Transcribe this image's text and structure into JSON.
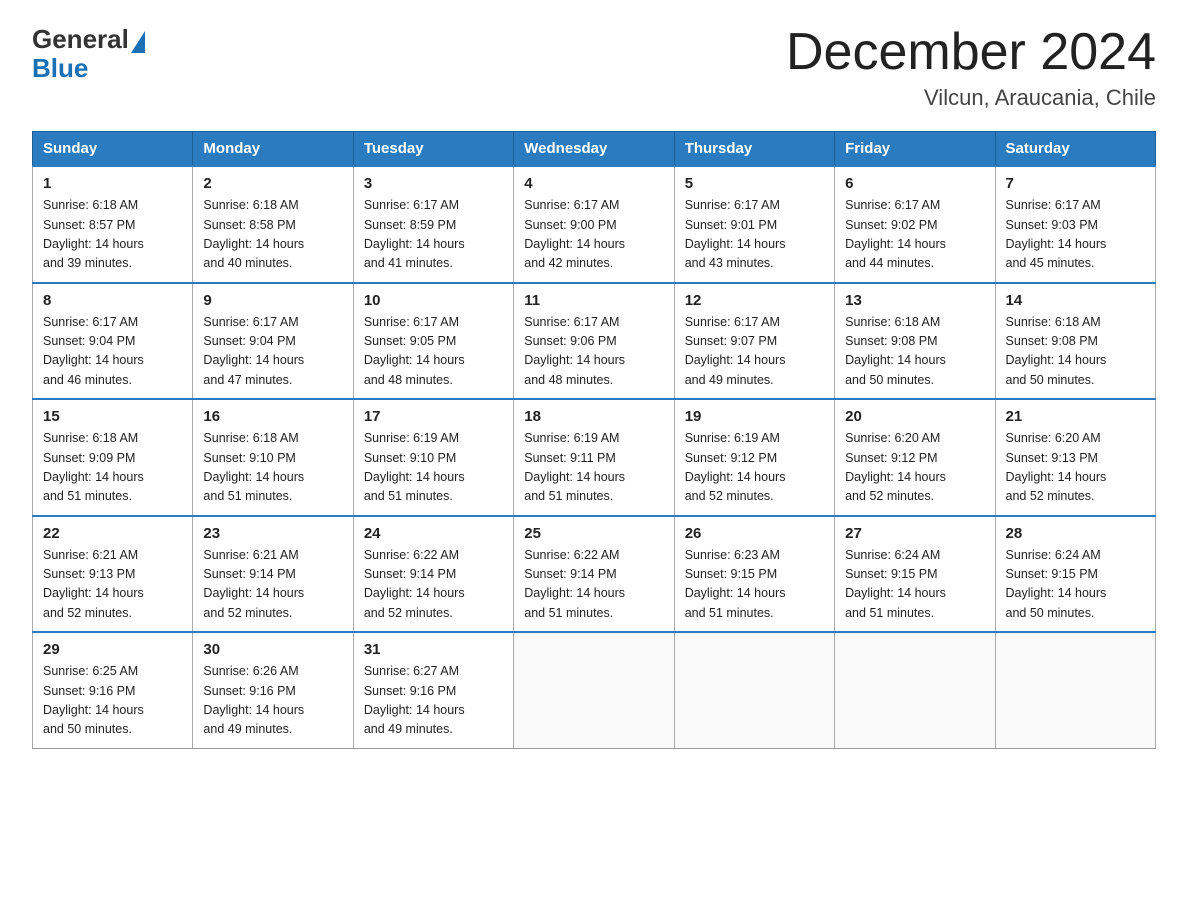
{
  "logo": {
    "general": "General",
    "blue": "Blue"
  },
  "title": "December 2024",
  "location": "Vilcun, Araucania, Chile",
  "headers": [
    "Sunday",
    "Monday",
    "Tuesday",
    "Wednesday",
    "Thursday",
    "Friday",
    "Saturday"
  ],
  "weeks": [
    [
      {
        "day": "1",
        "sunrise": "6:18 AM",
        "sunset": "8:57 PM",
        "daylight": "14 hours and 39 minutes."
      },
      {
        "day": "2",
        "sunrise": "6:18 AM",
        "sunset": "8:58 PM",
        "daylight": "14 hours and 40 minutes."
      },
      {
        "day": "3",
        "sunrise": "6:17 AM",
        "sunset": "8:59 PM",
        "daylight": "14 hours and 41 minutes."
      },
      {
        "day": "4",
        "sunrise": "6:17 AM",
        "sunset": "9:00 PM",
        "daylight": "14 hours and 42 minutes."
      },
      {
        "day": "5",
        "sunrise": "6:17 AM",
        "sunset": "9:01 PM",
        "daylight": "14 hours and 43 minutes."
      },
      {
        "day": "6",
        "sunrise": "6:17 AM",
        "sunset": "9:02 PM",
        "daylight": "14 hours and 44 minutes."
      },
      {
        "day": "7",
        "sunrise": "6:17 AM",
        "sunset": "9:03 PM",
        "daylight": "14 hours and 45 minutes."
      }
    ],
    [
      {
        "day": "8",
        "sunrise": "6:17 AM",
        "sunset": "9:04 PM",
        "daylight": "14 hours and 46 minutes."
      },
      {
        "day": "9",
        "sunrise": "6:17 AM",
        "sunset": "9:04 PM",
        "daylight": "14 hours and 47 minutes."
      },
      {
        "day": "10",
        "sunrise": "6:17 AM",
        "sunset": "9:05 PM",
        "daylight": "14 hours and 48 minutes."
      },
      {
        "day": "11",
        "sunrise": "6:17 AM",
        "sunset": "9:06 PM",
        "daylight": "14 hours and 48 minutes."
      },
      {
        "day": "12",
        "sunrise": "6:17 AM",
        "sunset": "9:07 PM",
        "daylight": "14 hours and 49 minutes."
      },
      {
        "day": "13",
        "sunrise": "6:18 AM",
        "sunset": "9:08 PM",
        "daylight": "14 hours and 50 minutes."
      },
      {
        "day": "14",
        "sunrise": "6:18 AM",
        "sunset": "9:08 PM",
        "daylight": "14 hours and 50 minutes."
      }
    ],
    [
      {
        "day": "15",
        "sunrise": "6:18 AM",
        "sunset": "9:09 PM",
        "daylight": "14 hours and 51 minutes."
      },
      {
        "day": "16",
        "sunrise": "6:18 AM",
        "sunset": "9:10 PM",
        "daylight": "14 hours and 51 minutes."
      },
      {
        "day": "17",
        "sunrise": "6:19 AM",
        "sunset": "9:10 PM",
        "daylight": "14 hours and 51 minutes."
      },
      {
        "day": "18",
        "sunrise": "6:19 AM",
        "sunset": "9:11 PM",
        "daylight": "14 hours and 51 minutes."
      },
      {
        "day": "19",
        "sunrise": "6:19 AM",
        "sunset": "9:12 PM",
        "daylight": "14 hours and 52 minutes."
      },
      {
        "day": "20",
        "sunrise": "6:20 AM",
        "sunset": "9:12 PM",
        "daylight": "14 hours and 52 minutes."
      },
      {
        "day": "21",
        "sunrise": "6:20 AM",
        "sunset": "9:13 PM",
        "daylight": "14 hours and 52 minutes."
      }
    ],
    [
      {
        "day": "22",
        "sunrise": "6:21 AM",
        "sunset": "9:13 PM",
        "daylight": "14 hours and 52 minutes."
      },
      {
        "day": "23",
        "sunrise": "6:21 AM",
        "sunset": "9:14 PM",
        "daylight": "14 hours and 52 minutes."
      },
      {
        "day": "24",
        "sunrise": "6:22 AM",
        "sunset": "9:14 PM",
        "daylight": "14 hours and 52 minutes."
      },
      {
        "day": "25",
        "sunrise": "6:22 AM",
        "sunset": "9:14 PM",
        "daylight": "14 hours and 51 minutes."
      },
      {
        "day": "26",
        "sunrise": "6:23 AM",
        "sunset": "9:15 PM",
        "daylight": "14 hours and 51 minutes."
      },
      {
        "day": "27",
        "sunrise": "6:24 AM",
        "sunset": "9:15 PM",
        "daylight": "14 hours and 51 minutes."
      },
      {
        "day": "28",
        "sunrise": "6:24 AM",
        "sunset": "9:15 PM",
        "daylight": "14 hours and 50 minutes."
      }
    ],
    [
      {
        "day": "29",
        "sunrise": "6:25 AM",
        "sunset": "9:16 PM",
        "daylight": "14 hours and 50 minutes."
      },
      {
        "day": "30",
        "sunrise": "6:26 AM",
        "sunset": "9:16 PM",
        "daylight": "14 hours and 49 minutes."
      },
      {
        "day": "31",
        "sunrise": "6:27 AM",
        "sunset": "9:16 PM",
        "daylight": "14 hours and 49 minutes."
      },
      null,
      null,
      null,
      null
    ]
  ],
  "labels": {
    "sunrise": "Sunrise:",
    "sunset": "Sunset:",
    "daylight": "Daylight:"
  }
}
